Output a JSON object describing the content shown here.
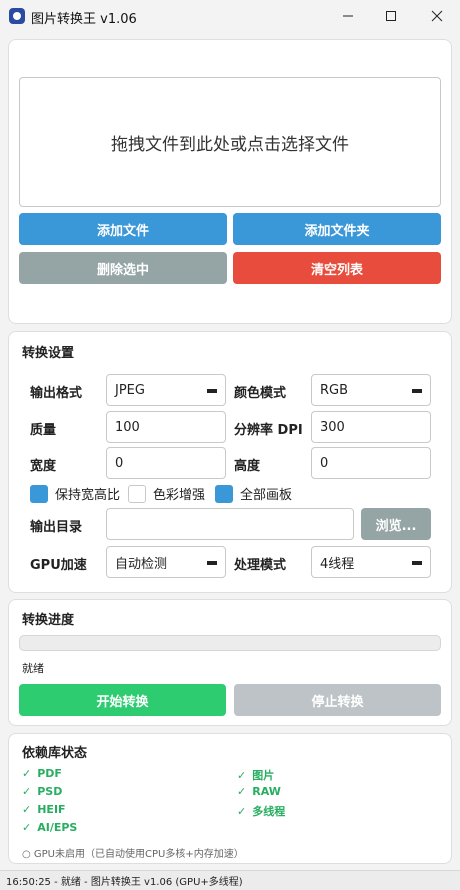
{
  "window": {
    "title": "图片转换王 v1.06",
    "icon": "app-icon",
    "min_icon": "minimize-icon",
    "max_icon": "maximize-icon",
    "close_icon": "close-icon"
  },
  "files": {
    "dropzone_text": "拖拽文件到此处或点击选择文件",
    "add_files": "添加文件",
    "add_folder": "添加文件夹",
    "remove_selected": "删除选中",
    "clear_list": "清空列表"
  },
  "settings": {
    "title": "转换设置",
    "output_format_label": "输出格式",
    "output_format_value": "JPEG",
    "color_mode_label": "颜色模式",
    "color_mode_value": "RGB",
    "quality_label": "质量",
    "quality_value": "100",
    "dpi_label": "分辨率 DPI",
    "dpi_value": "300",
    "width_label": "宽度",
    "width_value": "0",
    "height_label": "高度",
    "height_value": "0",
    "keep_ratio_label": "保持宽高比",
    "keep_ratio_checked": true,
    "color_enhance_label": "色彩增强",
    "color_enhance_checked": false,
    "all_artboards_label": "全部画板",
    "all_artboards_checked": true,
    "output_dir_label": "输出目录",
    "output_dir_value": "",
    "browse_label": "浏览...",
    "gpu_label": "GPU加速",
    "gpu_value": "自动检测",
    "mode_label": "处理模式",
    "mode_value": "4线程"
  },
  "progress": {
    "title": "转换进度",
    "value": 0,
    "status": "就绪",
    "start_label": "开始转换",
    "stop_label": "停止转换"
  },
  "deps": {
    "title": "依赖库状态",
    "check_glyph": "✓",
    "items": [
      "PDF",
      "图片",
      "PSD",
      "RAW",
      "HEIF",
      "多线程",
      "AI/EPS"
    ],
    "gpu_note": "○ GPU未启用（已自动使用CPU多核+内存加速）"
  },
  "statusbar": {
    "text": "16:50:25 - 就绪 - 图片转换王 v1.06 (GPU+多线程)"
  },
  "colors": {
    "primary": "#3a97d8",
    "danger": "#e74c3c",
    "neutral": "#95a5a6",
    "success": "#2ecc71",
    "ok_text": "#27ae60"
  }
}
